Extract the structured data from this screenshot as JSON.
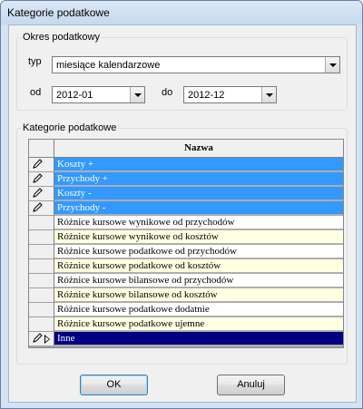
{
  "window": {
    "title": "Kategorie podatkowe"
  },
  "period_group": {
    "legend": "Okres podatkowy",
    "type_label": "typ",
    "type_value": "miesiące kalendarzowe",
    "from_label": "od",
    "from_value": "2012-01",
    "to_label": "do",
    "to_value": "2012-12"
  },
  "categories_group": {
    "legend": "Kategorie podatkowe",
    "column_header": "Nazwa",
    "rows": [
      {
        "name": "Koszty +",
        "style": "selected",
        "checked": true,
        "current": false
      },
      {
        "name": "Przychody +",
        "style": "selected",
        "checked": true,
        "current": false
      },
      {
        "name": "Koszty -",
        "style": "selected",
        "checked": true,
        "current": false
      },
      {
        "name": "Przychody -",
        "style": "selected",
        "checked": true,
        "current": false
      },
      {
        "name": "Różnice kursowe wynikowe od przychodów",
        "style": "white",
        "checked": false,
        "current": false
      },
      {
        "name": "Różnice kursowe wynikowe od kosztów",
        "style": "cream",
        "checked": false,
        "current": false
      },
      {
        "name": "Różnice kursowe podatkowe od przychodów",
        "style": "white",
        "checked": false,
        "current": false
      },
      {
        "name": "Różnice kursowe podatkowe od kosztów",
        "style": "cream",
        "checked": false,
        "current": false
      },
      {
        "name": "Różnice kursowe bilansowe od przychodów",
        "style": "white",
        "checked": false,
        "current": false
      },
      {
        "name": "Różnice kursowe bilansowe od kosztów",
        "style": "cream",
        "checked": false,
        "current": false
      },
      {
        "name": "Różnice kursowe podatkowe dodatnie",
        "style": "white",
        "checked": false,
        "current": false
      },
      {
        "name": "Różnice kursowe podatkowe ujemne",
        "style": "cream",
        "checked": false,
        "current": false
      },
      {
        "name": "Inne",
        "style": "current",
        "checked": true,
        "current": true
      }
    ]
  },
  "buttons": {
    "ok": "OK",
    "cancel": "Anuluj"
  },
  "colors": {
    "selected_bg": "#3399ff",
    "current_bg": "#000080",
    "row_white": "#ffffff",
    "row_cream": "#ffffe1"
  },
  "icons": {
    "checked_indicator": "pencil-icon",
    "current_indicator": "row-pointer-icon"
  }
}
